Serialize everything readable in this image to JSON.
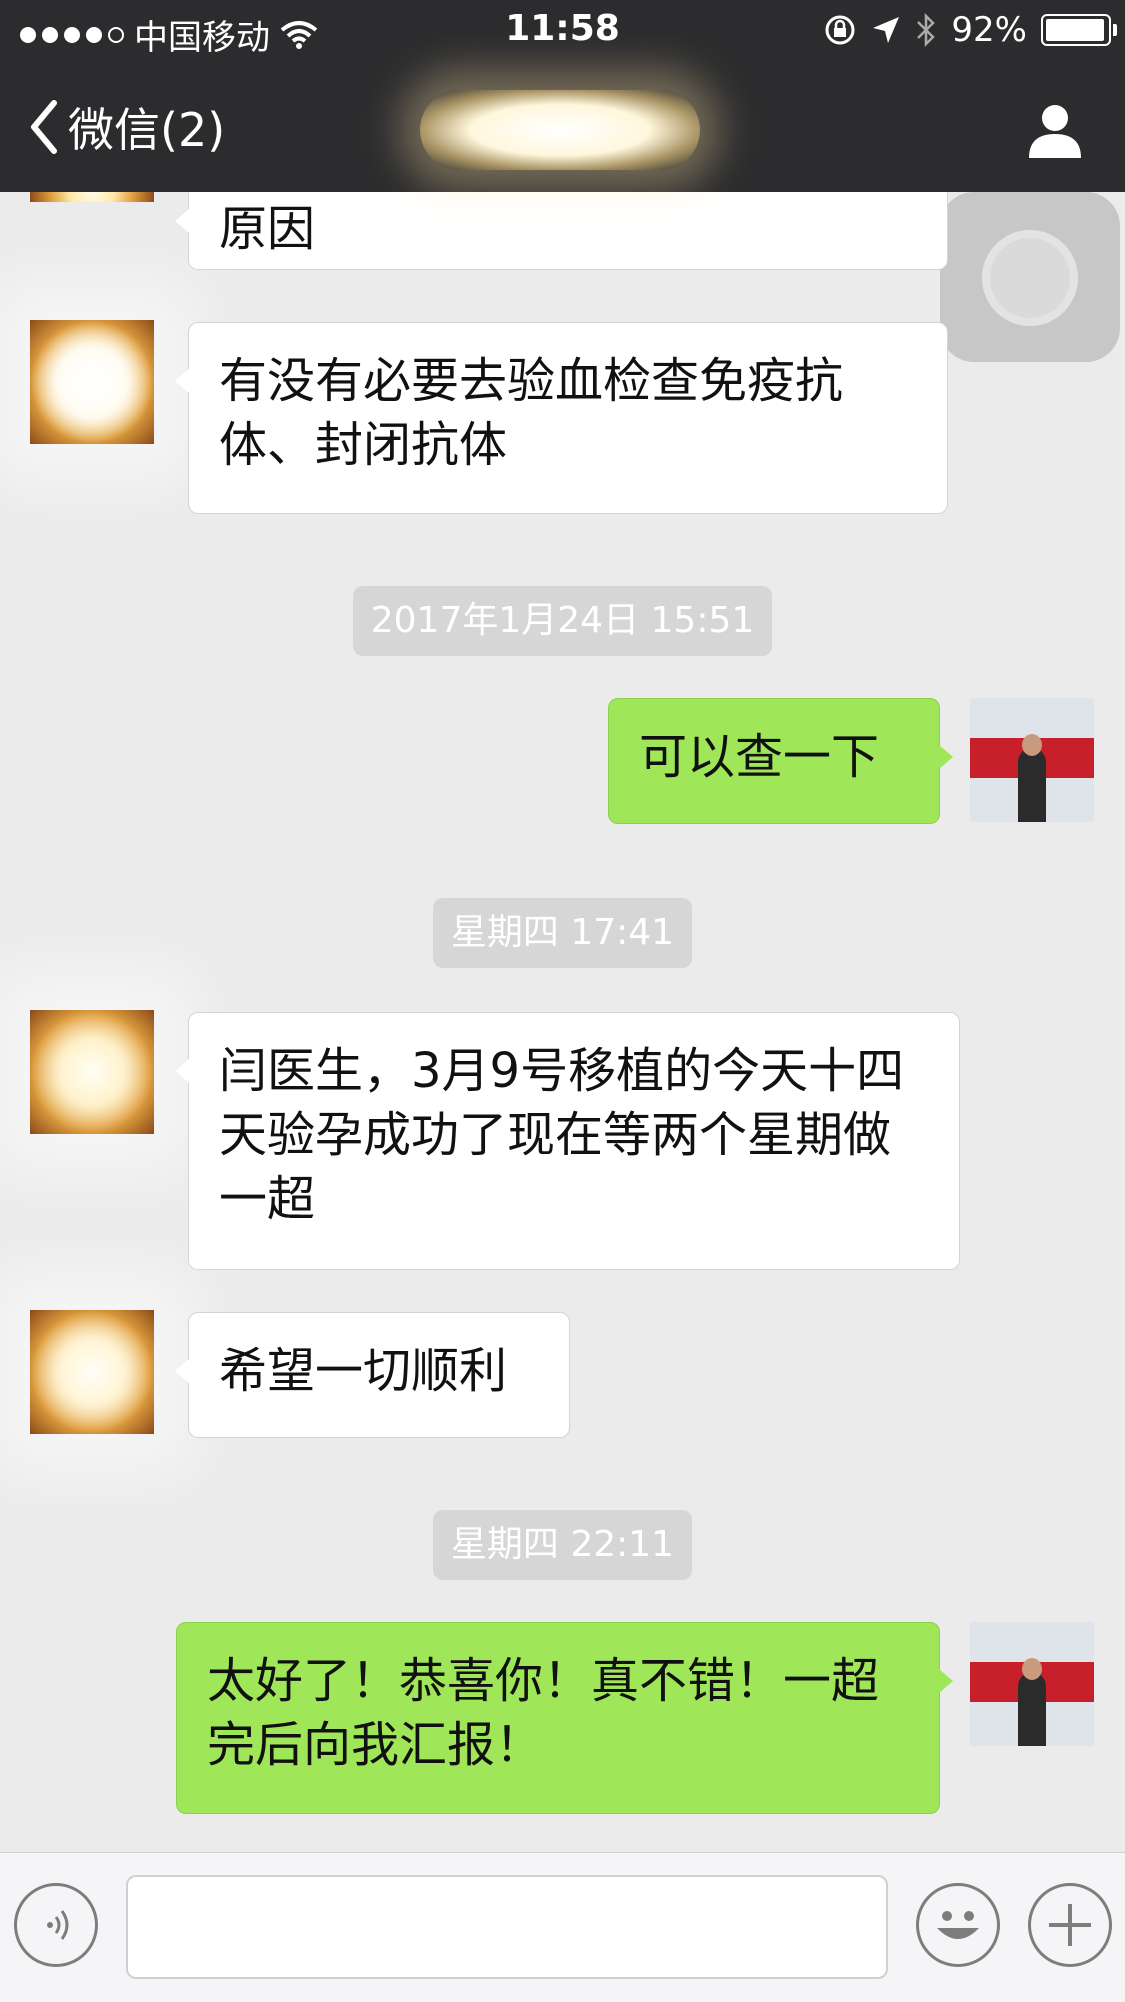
{
  "status_bar": {
    "carrier": "中国移动",
    "time": "11:58",
    "battery": "92%",
    "battery_level": 0.92
  },
  "nav": {
    "back_label": "微信(2)"
  },
  "messages": [
    {
      "side": "left",
      "text": "原因"
    },
    {
      "side": "left",
      "text": "有没有必要去验血检查免疫抗体、封闭抗体"
    },
    {
      "timestamp": "2017年1月24日 15:51"
    },
    {
      "side": "right",
      "text": "可以查一下"
    },
    {
      "timestamp": "星期四 17:41"
    },
    {
      "side": "left",
      "text": "闫医生，3月9号移植的今天十四天验孕成功了现在等两个星期做一超"
    },
    {
      "side": "left",
      "text": "希望一切顺利"
    },
    {
      "timestamp": "星期四 22:11"
    },
    {
      "side": "right",
      "text": "太好了！恭喜你！真不错！一超完后向我汇报！"
    }
  ],
  "icons": {
    "signal": "signal-dots-icon",
    "wifi": "wifi-icon",
    "lock_rotation": "rotation-lock-icon",
    "location": "location-arrow-icon",
    "bluetooth": "bluetooth-icon",
    "battery": "battery-icon",
    "back": "chevron-left-icon",
    "profile": "person-icon",
    "voice": "voice-icon",
    "emoji": "emoji-icon",
    "plus": "plus-icon"
  },
  "colors": {
    "nav_bg": "#2c2c2e",
    "chat_bg": "#ebebeb",
    "bubble_in": "#ffffff",
    "bubble_out": "#9fe659",
    "timestamp_bg": "#d6d6d6"
  }
}
